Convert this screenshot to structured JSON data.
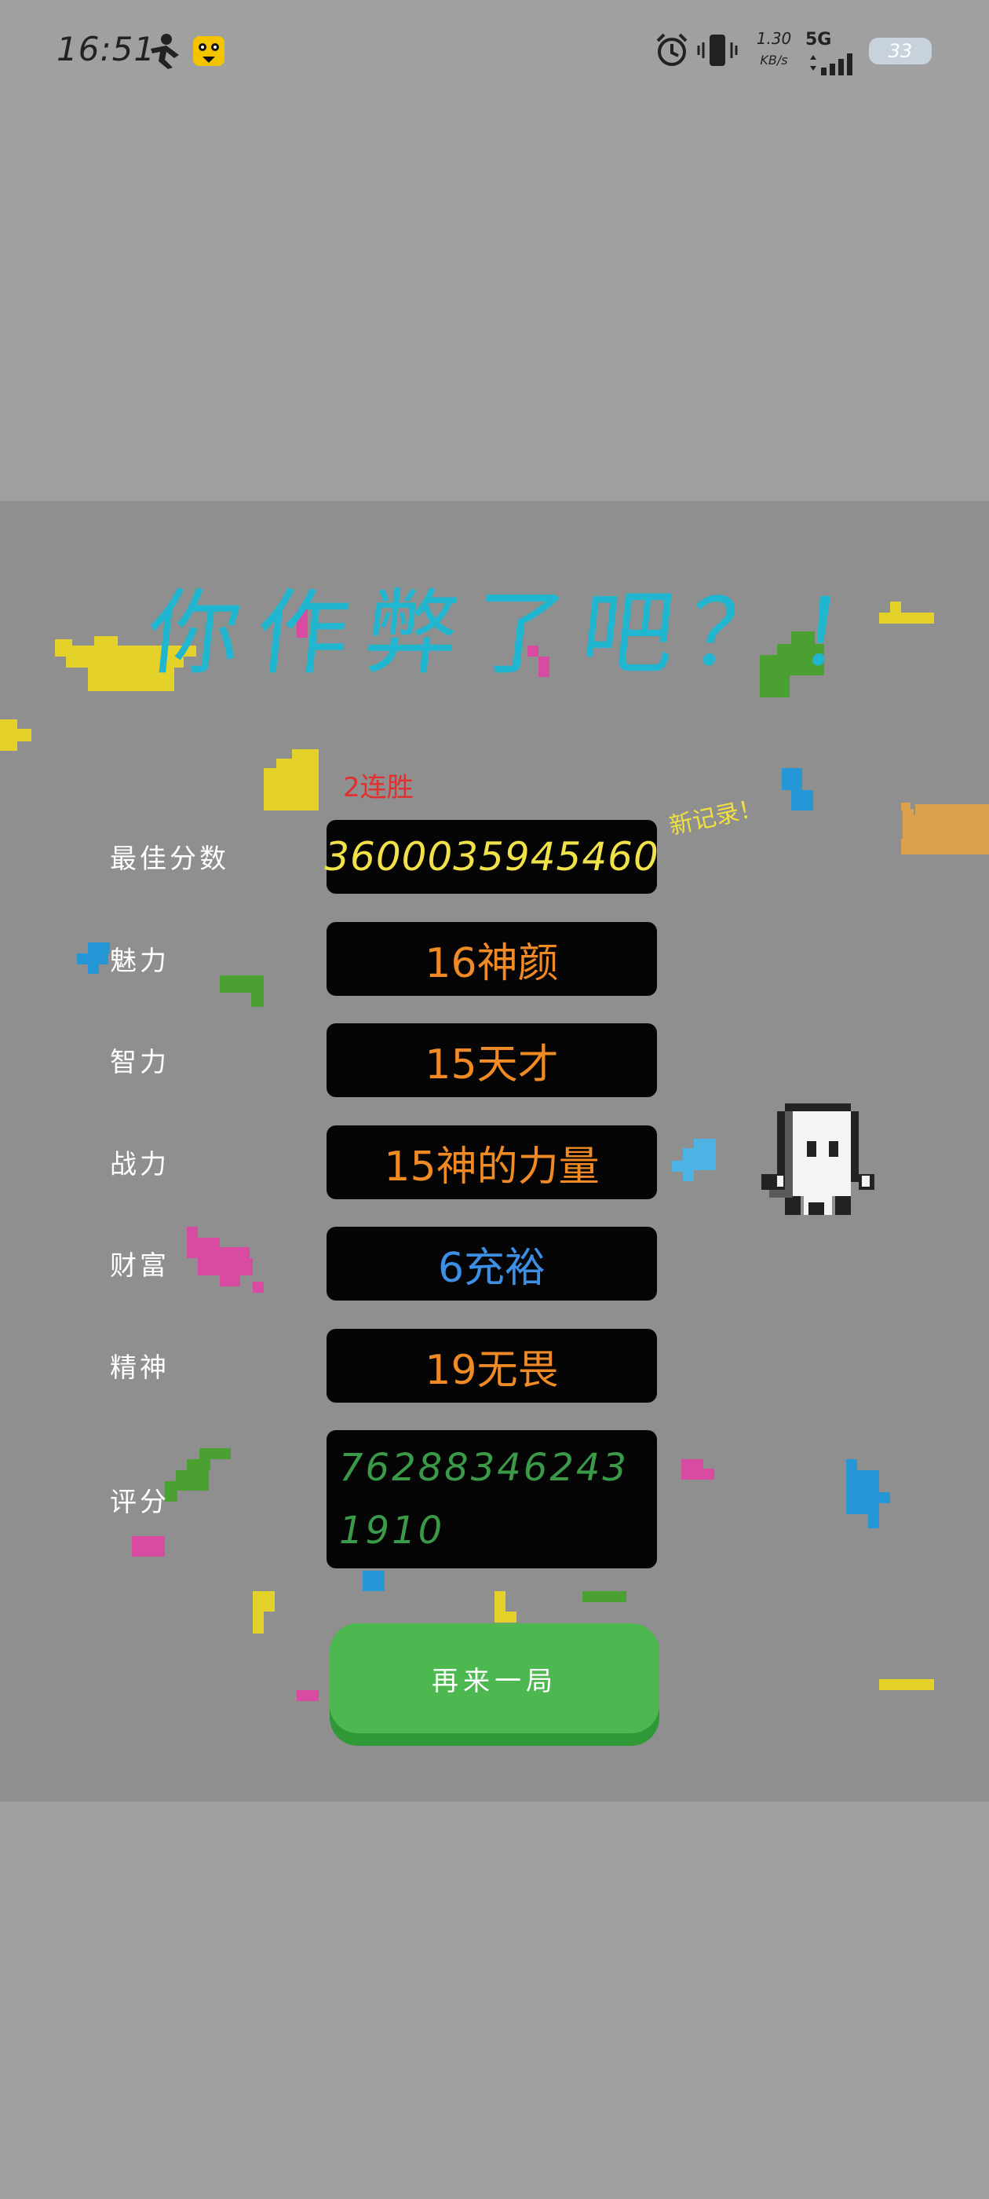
{
  "status_bar": {
    "time": "16:51",
    "network_speed": "1.30",
    "network_unit": "KB/s",
    "network_type": "5G",
    "battery": "33",
    "icons": [
      "person-icon",
      "app-cat-icon",
      "alarm-icon",
      "vibrate-icon",
      "signal-icon",
      "battery-icon"
    ]
  },
  "result": {
    "title": "你作弊了吧？！",
    "streak": "2连胜",
    "new_record": "新记录！",
    "rows": [
      {
        "label": "最佳分数",
        "value": "3600035945460"
      },
      {
        "label": "魅力",
        "value": "16神颜"
      },
      {
        "label": "智力",
        "value": "15天才"
      },
      {
        "label": "战力",
        "value": "15神的力量"
      },
      {
        "label": "财富",
        "value": "6充裕"
      },
      {
        "label": "精神",
        "value": "19无畏"
      }
    ],
    "rating_label": "评分",
    "rating_value": "762883462431910",
    "restart_button": "再来一局"
  },
  "colors": {
    "title": "#21b6cf",
    "score": "#f2e24a",
    "orange_value": "#f08a24",
    "blue_value": "#3d8fe6",
    "rating": "#3b9a48",
    "button": "#4cb84f",
    "streak": "#e03030"
  }
}
